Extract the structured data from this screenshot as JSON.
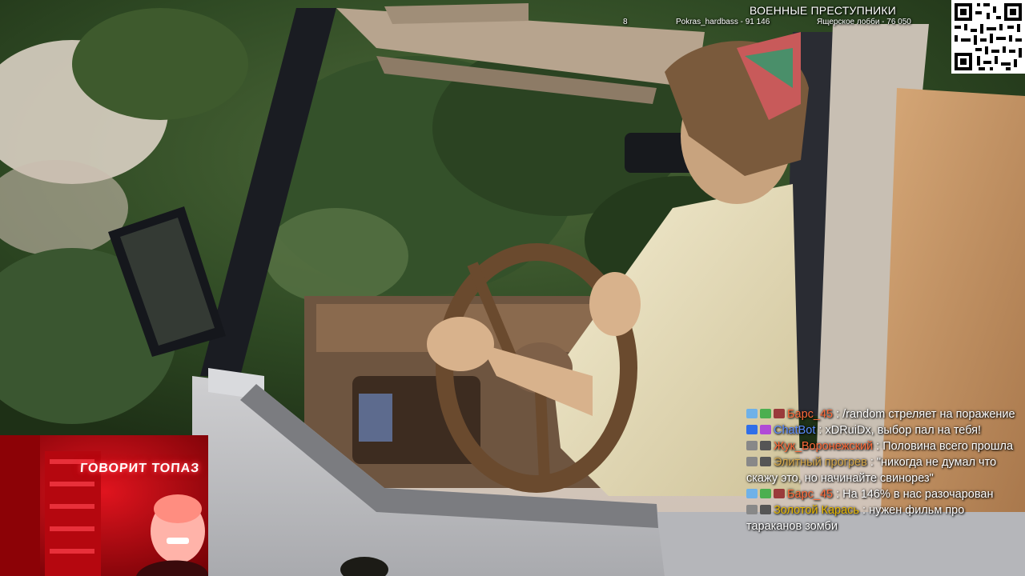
{
  "scoreboard": {
    "title": "ВОЕННЫЕ ПРЕСТУПНИКИ",
    "count": "8",
    "entries": [
      {
        "text": "Pokras_hardbass - 91 146"
      },
      {
        "text": "Ящерское лобби - 76 050"
      }
    ]
  },
  "webcam": {
    "sign_text": "ГОВОРИТ ТОПАЗ"
  },
  "chat": {
    "messages": [
      {
        "user": "Барс_45",
        "text": "/random стреляет на поражение",
        "user_color": "#ff6b3a",
        "badges": [
          "prime-badge",
          "verified-badge",
          "sub-badge"
        ]
      },
      {
        "user": "ChatBot",
        "text": "xDRuiDx, выбор пал на тебя!",
        "user_color": "#5b8cff",
        "badges": [
          "bot-badge",
          "space-invader-badge"
        ]
      },
      {
        "user": "Жук_Воронежский",
        "text": "Половина всего прошла",
        "user_color": "#ff6b3a",
        "badges": [
          "gift-badge",
          "sub-badge"
        ]
      },
      {
        "user": "Элитный прогрев",
        "text": "\"никогда не думал что скажу это, но начинайте свинорез\"",
        "user_color": "#d6a84a",
        "badges": [
          "gift-badge",
          "sub-badge"
        ]
      },
      {
        "user": "Барс_45",
        "text": "На 146% в нас разочарован",
        "user_color": "#ff6b3a",
        "badges": [
          "prime-badge",
          "verified-badge",
          "sub-badge"
        ]
      },
      {
        "user": "Золотой Карась",
        "text": "нужен фильм про тараканов зомби",
        "user_color": "#e6b800",
        "badges": [
          "gift-badge",
          "sub-badge"
        ]
      }
    ]
  },
  "colors": {
    "chat_user_orange": "#ff6b3a",
    "chat_user_blue": "#5b8cff",
    "chat_user_gold": "#d6a84a",
    "webcam_tint": "#e0141e"
  }
}
